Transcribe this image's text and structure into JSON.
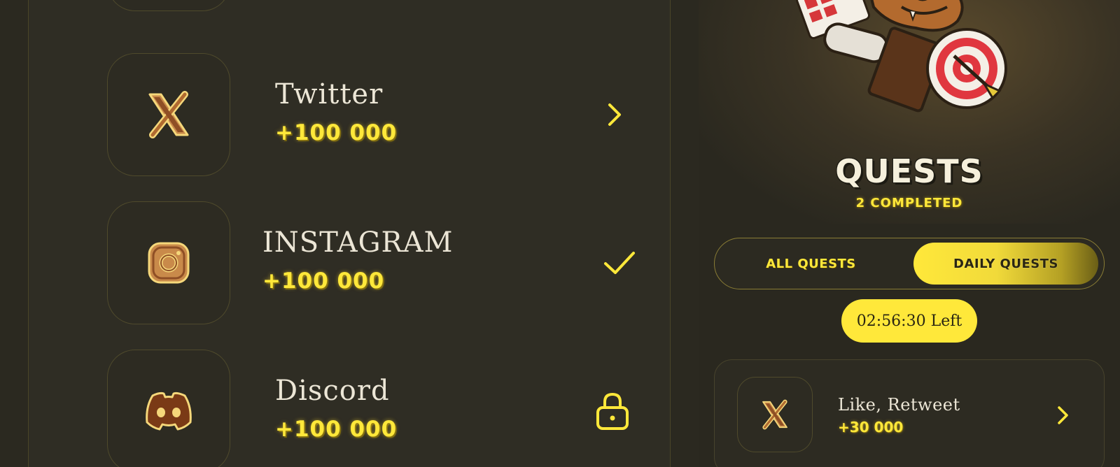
{
  "quest_list": {
    "rows": [
      {
        "title": "Twitter",
        "reward": "+100 000",
        "icon": "x-logo-icon",
        "status": "open",
        "action_icon": "chevron-right-icon"
      },
      {
        "title": "INSTAGRAM",
        "reward": "+100 000",
        "icon": "instagram-icon",
        "status": "completed",
        "action_icon": "checkmark-icon"
      },
      {
        "title": "Discord",
        "reward": "+100 000",
        "icon": "discord-icon",
        "status": "locked",
        "action_icon": "lock-icon"
      }
    ]
  },
  "header": {
    "title": "QUESTS",
    "subtitle": "2 COMPLETED",
    "hero_illustration": "dinosaur-mascot-with-target-and-cards"
  },
  "tabs": [
    {
      "label": "ALL QUESTS",
      "active": false
    },
    {
      "label": "DAILY QUESTS",
      "active": true
    }
  ],
  "timer": {
    "text": "02:56:30 Left"
  },
  "daily_quests": [
    {
      "title": "Like, Retweet",
      "reward": "+30 000",
      "icon": "x-logo-icon",
      "action_icon": "chevron-right-icon"
    }
  ],
  "colors": {
    "background": "#2b2920",
    "accent_yellow": "#ffe83a",
    "border_gold": "#8a7d35",
    "text_light": "#ece6d6"
  }
}
